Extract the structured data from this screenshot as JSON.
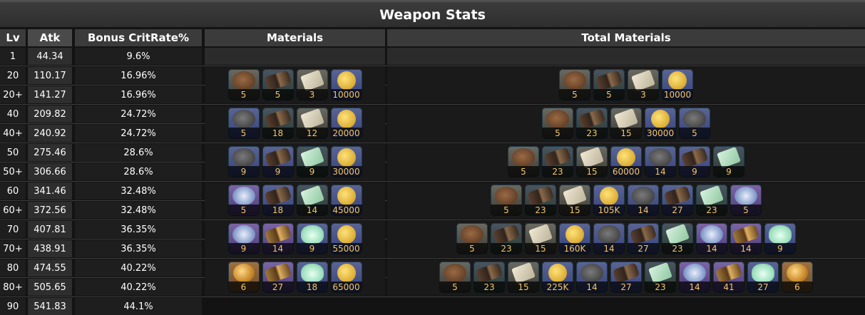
{
  "title": "Weapon Stats",
  "headers": {
    "lv": "Lv",
    "atk": "Atk",
    "crit": "Bonus CritRate%",
    "materials": "Materials",
    "total": "Total Materials"
  },
  "rows": [
    {
      "lv": "1",
      "atk": "44.34",
      "crit": "9.6%"
    },
    {
      "lv": "20",
      "atk": "110.17",
      "crit": "16.96%"
    },
    {
      "lv": "20+",
      "atk": "141.27",
      "crit": "16.96%"
    },
    {
      "lv": "40",
      "atk": "209.82",
      "crit": "24.72%"
    },
    {
      "lv": "40+",
      "atk": "240.92",
      "crit": "24.72%"
    },
    {
      "lv": "50",
      "atk": "275.46",
      "crit": "28.6%"
    },
    {
      "lv": "50+",
      "atk": "306.66",
      "crit": "28.6%"
    },
    {
      "lv": "60",
      "atk": "341.46",
      "crit": "32.48%"
    },
    {
      "lv": "60+",
      "atk": "372.56",
      "crit": "32.48%"
    },
    {
      "lv": "70",
      "atk": "407.81",
      "crit": "36.35%"
    },
    {
      "lv": "70+",
      "atk": "438.91",
      "crit": "36.35%"
    },
    {
      "lv": "80",
      "atk": "474.55",
      "crit": "40.22%"
    },
    {
      "lv": "80+",
      "atk": "505.65",
      "crit": "40.22%"
    },
    {
      "lv": "90",
      "atk": "541.83",
      "crit": "44.1%"
    }
  ],
  "materials": [
    [
      {
        "icon": "brown-hat-icon",
        "count": "5"
      },
      {
        "icon": "dark-barrel-icon",
        "count": "5"
      },
      {
        "icon": "scroll-icon",
        "count": "3"
      },
      {
        "icon": "mora-coin-icon",
        "count": "10000"
      }
    ],
    [
      {
        "icon": "gray-hat-icon",
        "count": "5"
      },
      {
        "icon": "dark-barrel-icon",
        "count": "18"
      },
      {
        "icon": "scroll-icon",
        "count": "12"
      },
      {
        "icon": "mora-coin-icon",
        "count": "20000"
      }
    ],
    [
      {
        "icon": "gray-hat-icon",
        "count": "9"
      },
      {
        "icon": "bronze-barrel-icon",
        "count": "9"
      },
      {
        "icon": "green-scroll-icon",
        "count": "9"
      },
      {
        "icon": "mora-coin-icon",
        "count": "30000"
      }
    ],
    [
      {
        "icon": "shell-icon",
        "count": "5"
      },
      {
        "icon": "bronze-barrel-icon",
        "count": "18"
      },
      {
        "icon": "green-scroll-icon",
        "count": "14"
      },
      {
        "icon": "mora-coin-icon",
        "count": "45000"
      }
    ],
    [
      {
        "icon": "shell-icon",
        "count": "9"
      },
      {
        "icon": "gold-barrel-icon",
        "count": "14"
      },
      {
        "icon": "mint-icon",
        "count": "9"
      },
      {
        "icon": "mora-coin-icon",
        "count": "55000"
      }
    ],
    [
      {
        "icon": "gold-medal-icon",
        "count": "6"
      },
      {
        "icon": "gold-barrel-icon",
        "count": "27"
      },
      {
        "icon": "mint-icon",
        "count": "18"
      },
      {
        "icon": "mora-coin-icon",
        "count": "65000"
      }
    ]
  ],
  "totals": [
    [
      {
        "icon": "brown-hat-icon",
        "count": "5"
      },
      {
        "icon": "dark-barrel-icon",
        "count": "5"
      },
      {
        "icon": "scroll-icon",
        "count": "3"
      },
      {
        "icon": "mora-coin-icon",
        "count": "10000"
      }
    ],
    [
      {
        "icon": "brown-hat-icon",
        "count": "5"
      },
      {
        "icon": "dark-barrel-icon",
        "count": "23"
      },
      {
        "icon": "scroll-icon",
        "count": "15"
      },
      {
        "icon": "mora-coin-icon",
        "count": "30000"
      },
      {
        "icon": "gray-hat-icon",
        "count": "5"
      }
    ],
    [
      {
        "icon": "brown-hat-icon",
        "count": "5"
      },
      {
        "icon": "dark-barrel-icon",
        "count": "23"
      },
      {
        "icon": "scroll-icon",
        "count": "15"
      },
      {
        "icon": "mora-coin-icon",
        "count": "60000"
      },
      {
        "icon": "gray-hat-icon",
        "count": "14"
      },
      {
        "icon": "bronze-barrel-icon",
        "count": "9"
      },
      {
        "icon": "green-scroll-icon",
        "count": "9"
      }
    ],
    [
      {
        "icon": "brown-hat-icon",
        "count": "5"
      },
      {
        "icon": "dark-barrel-icon",
        "count": "23"
      },
      {
        "icon": "scroll-icon",
        "count": "15"
      },
      {
        "icon": "mora-coin-icon",
        "count": "105K"
      },
      {
        "icon": "gray-hat-icon",
        "count": "14"
      },
      {
        "icon": "bronze-barrel-icon",
        "count": "27"
      },
      {
        "icon": "green-scroll-icon",
        "count": "23"
      },
      {
        "icon": "shell-icon",
        "count": "5"
      }
    ],
    [
      {
        "icon": "brown-hat-icon",
        "count": "5"
      },
      {
        "icon": "dark-barrel-icon",
        "count": "23"
      },
      {
        "icon": "scroll-icon",
        "count": "15"
      },
      {
        "icon": "mora-coin-icon",
        "count": "160K"
      },
      {
        "icon": "gray-hat-icon",
        "count": "14"
      },
      {
        "icon": "bronze-barrel-icon",
        "count": "27"
      },
      {
        "icon": "green-scroll-icon",
        "count": "23"
      },
      {
        "icon": "shell-icon",
        "count": "14"
      },
      {
        "icon": "gold-barrel-icon",
        "count": "14"
      },
      {
        "icon": "mint-icon",
        "count": "9"
      }
    ],
    [
      {
        "icon": "brown-hat-icon",
        "count": "5"
      },
      {
        "icon": "dark-barrel-icon",
        "count": "23"
      },
      {
        "icon": "scroll-icon",
        "count": "15"
      },
      {
        "icon": "mora-coin-icon",
        "count": "225K"
      },
      {
        "icon": "gray-hat-icon",
        "count": "14"
      },
      {
        "icon": "bronze-barrel-icon",
        "count": "27"
      },
      {
        "icon": "green-scroll-icon",
        "count": "23"
      },
      {
        "icon": "shell-icon",
        "count": "14"
      },
      {
        "icon": "gold-barrel-icon",
        "count": "41"
      },
      {
        "icon": "mint-icon",
        "count": "27"
      },
      {
        "icon": "gold-medal-icon",
        "count": "6"
      }
    ]
  ],
  "colors": {
    "accent": "#f3c66a",
    "header_bg": "#3b3b3b",
    "body_bg": "#131313"
  }
}
